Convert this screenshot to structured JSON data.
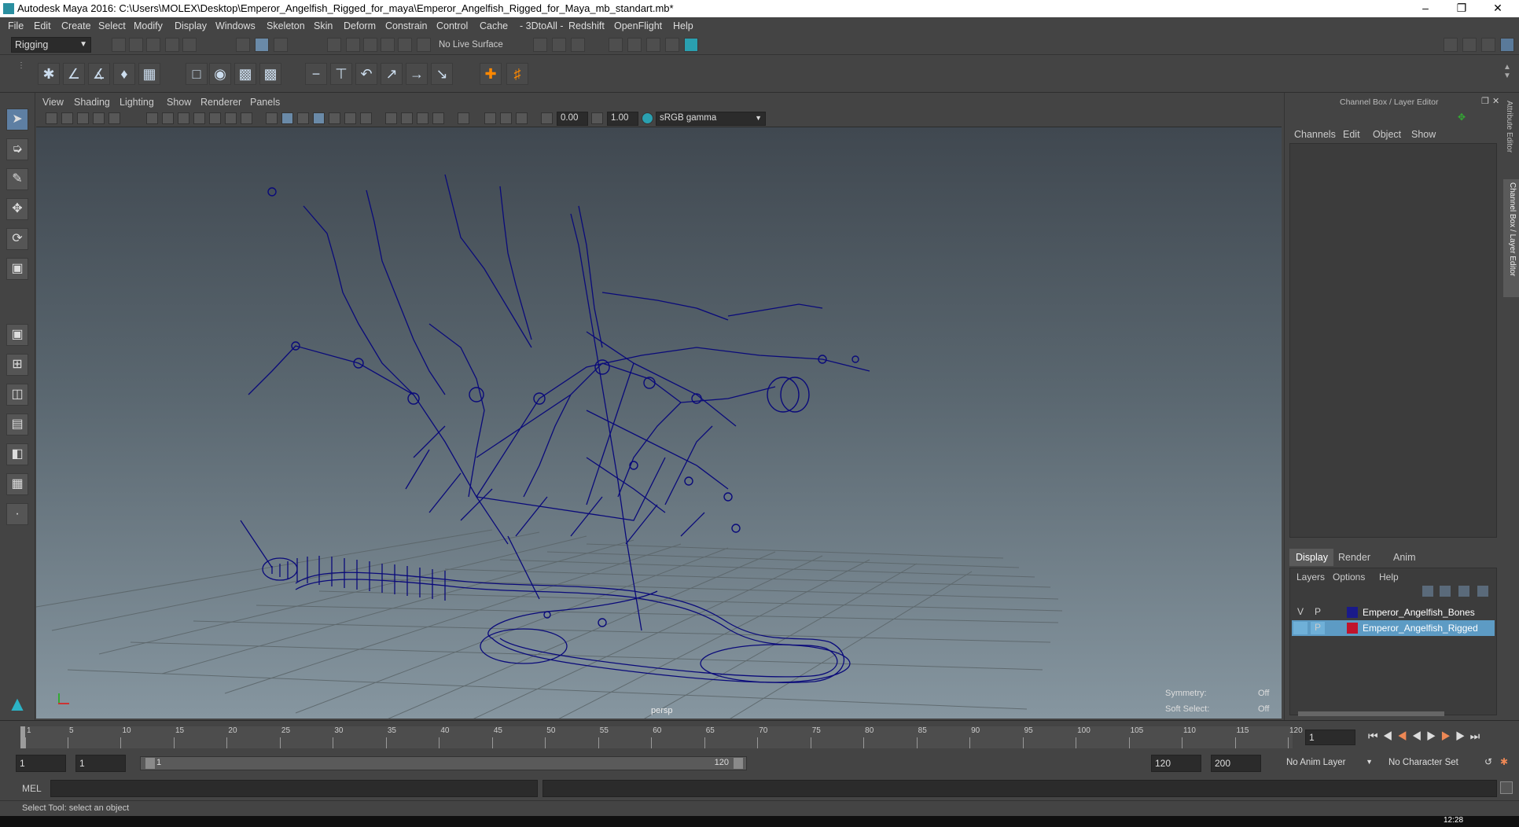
{
  "window": {
    "title": "Autodesk Maya 2016: C:\\Users\\MOLEX\\Desktop\\Emperor_Angelfish_Rigged_for_maya\\Emperor_Angelfish_Rigged_for_Maya_mb_standart.mb*",
    "controls": [
      "minimize-icon",
      "restore-icon",
      "close-icon"
    ]
  },
  "menubar": [
    "File",
    "Edit",
    "Create",
    "Select",
    "Modify",
    "Display",
    "Windows",
    "Skeleton",
    "Skin",
    "Deform",
    "Constrain",
    "Control",
    "Cache",
    "- 3DtoAll -",
    "Redshift",
    "OpenFlight",
    "Help"
  ],
  "statusline": {
    "menuset": "Rigging",
    "live_surface": "No Live Surface"
  },
  "viewport": {
    "menus": [
      "View",
      "Shading",
      "Lighting",
      "Show",
      "Renderer",
      "Panels"
    ],
    "exposure": "0.00",
    "gamma": "1.00",
    "colorspace": "sRGB gamma",
    "camera": "persp",
    "symmetry_label": "Symmetry:",
    "symmetry_value": "Off",
    "soft_select_label": "Soft Select:",
    "soft_select_value": "Off",
    "wire_color": "#0a0a7a"
  },
  "channelbox": {
    "title": "Channel Box / Layer Editor",
    "menus": [
      "Channels",
      "Edit",
      "Object",
      "Show"
    ],
    "layer_tabs": [
      "Display",
      "Render",
      "Anim"
    ],
    "layer_menus": [
      "Layers",
      "Options",
      "Help"
    ],
    "layers": [
      {
        "v": "V",
        "p": "P",
        "name": "Emperor_Angelfish_Bones",
        "color": "#1a1a8a",
        "selected": false
      },
      {
        "v": "",
        "p": "P",
        "name": "Emperor_Angelfish_Rigged",
        "color": "#c0142c",
        "selected": true
      }
    ],
    "side_tabs": [
      "Attribute Editor",
      "Channel Box / Layer Editor"
    ]
  },
  "timeline": {
    "ticks": [
      "1",
      "5",
      "10",
      "15",
      "20",
      "25",
      "30",
      "35",
      "40",
      "45",
      "50",
      "55",
      "60",
      "65",
      "70",
      "75",
      "80",
      "85",
      "90",
      "95",
      "100",
      "105",
      "110",
      "115",
      "120"
    ],
    "current_frame": "1"
  },
  "range": {
    "start": "1",
    "anim_start": "1",
    "slider_start": "1",
    "slider_end": "120",
    "anim_end": "120",
    "end": "200",
    "anim_layer": "No Anim Layer",
    "char_set": "No Character Set"
  },
  "cmd": {
    "label": "MEL"
  },
  "help": {
    "text": "Select Tool: select an object"
  },
  "taskbar": {
    "clock": "12:28"
  }
}
